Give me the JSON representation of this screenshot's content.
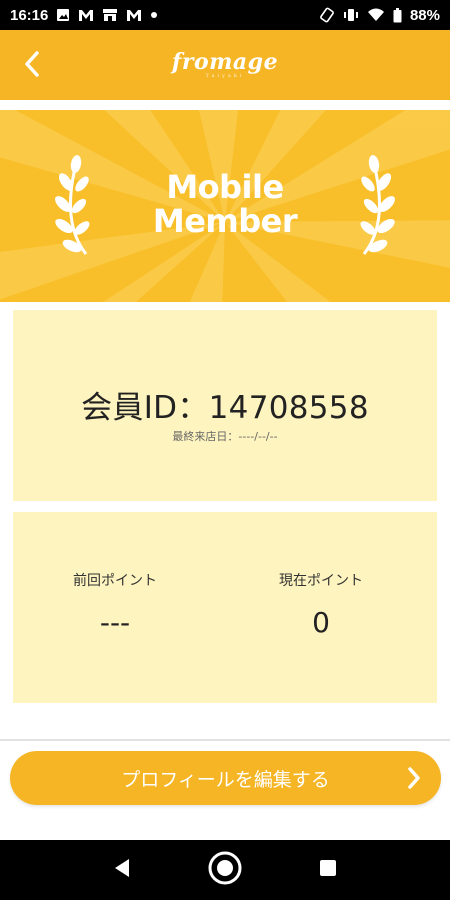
{
  "status_bar": {
    "time": "16:16",
    "battery": "88%",
    "left_icons": [
      "image-icon",
      "gmail-icon",
      "store-icon",
      "gmail-icon",
      "dot-icon"
    ],
    "right_icons": [
      "rotate-icon",
      "vibrate-icon",
      "wifi-icon",
      "battery-icon"
    ]
  },
  "header": {
    "brand": "fromage",
    "brand_sub": "Taiyaki",
    "back_icon": "chevron-left-icon"
  },
  "hero": {
    "title_line1": "Mobile",
    "title_line2": "Member",
    "decoration_icon": "laurel-icon"
  },
  "member": {
    "id_text": "会員ID：14708558",
    "last_visit_text": "最終来店日：----/--/--"
  },
  "points": {
    "previous_label": "前回ポイント",
    "previous_value": "---",
    "current_label": "現在ポイント",
    "current_value": "0"
  },
  "edit_button": {
    "label": "プロフィールを編集する",
    "icon": "chevron-right-icon"
  },
  "nav": {
    "back_icon": "nav-back-icon",
    "home_icon": "nav-home-icon",
    "recents_icon": "nav-recents-icon"
  },
  "colors": {
    "accent": "#f5b524",
    "hero_bg": "#f8bf2b",
    "panel_bg": "#fef4bf"
  }
}
